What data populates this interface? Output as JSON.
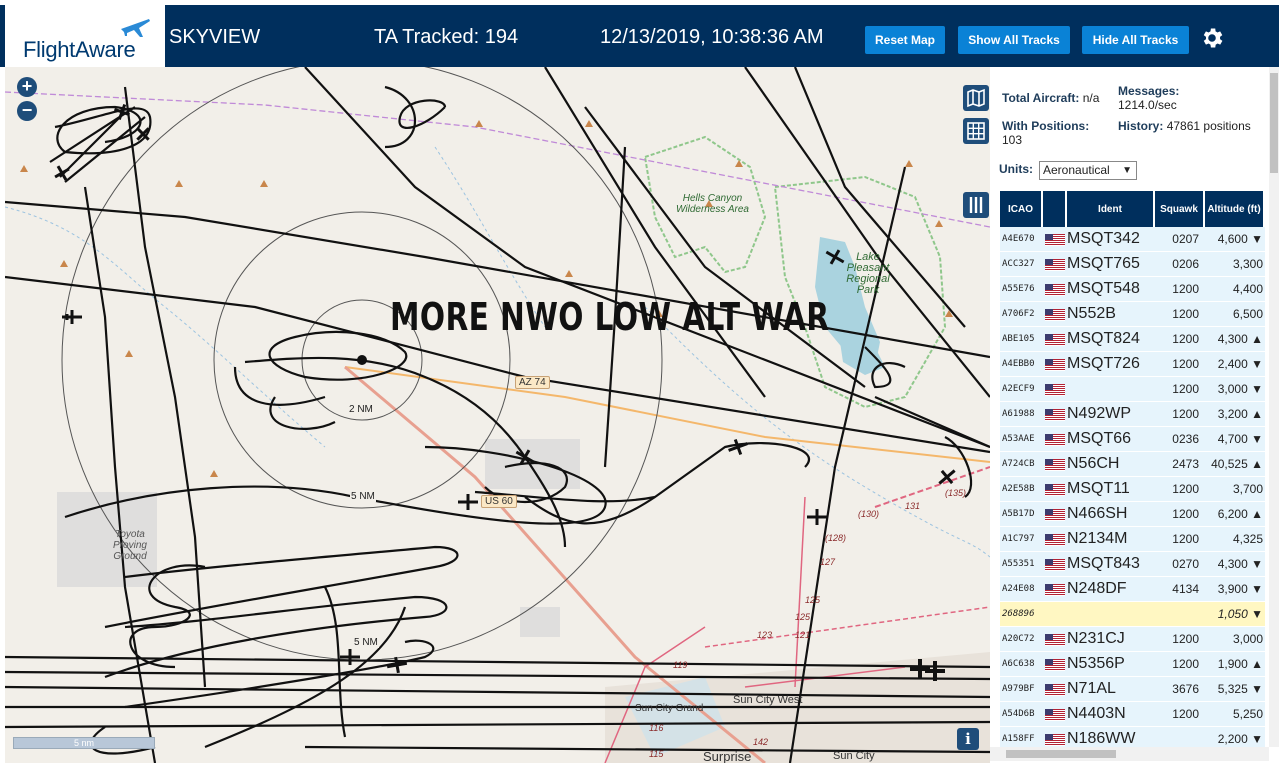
{
  "header": {
    "logo_text": "FlightAware",
    "app_title": "SKYVIEW",
    "tracked": "TA Tracked: 194",
    "datetime": "12/13/2019, 10:38:36 AM",
    "btn_reset": "Reset Map",
    "btn_show": "Show All Tracks",
    "btn_hide": "Hide All Tracks",
    "bar_color": "#002f5d",
    "button_color": "#0a82d6"
  },
  "map": {
    "overlay_title": "MORE NWO LOW ALT WAR",
    "zoom_in": "+",
    "zoom_out": "−",
    "info": "i",
    "scale": "5 nm",
    "range_labels": [
      "2 NM",
      "5 NM",
      "5 NM"
    ],
    "road_az74": "AZ 74",
    "road_us60": "US 60",
    "poi_hells_canyon": "Hells Canyon Wilderness Area",
    "poi_pleasant": "Lake Pleasant Regional Park",
    "poi_toyota": "Toyota Proving Ground",
    "town_sun_city_west": "Sun City West",
    "town_sun_city_grand": "Sun City Grand",
    "town_surprise": "Surprise",
    "town_sun_city": "Sun City",
    "route_numbers": [
      "(130)",
      "(128)",
      "127",
      "125",
      "123",
      "(135)",
      "131",
      "119",
      "116",
      "142",
      "115",
      "125",
      "121"
    ]
  },
  "sidebar": {
    "total_aircraft_label": "Total Aircraft:",
    "total_aircraft_value": "n/a",
    "with_positions_label": "With Positions:",
    "with_positions_value": "103",
    "messages_label": "Messages:",
    "messages_value": "1214.0/sec",
    "history_label": "History:",
    "history_value": "47861 positions",
    "units_label": "Units:",
    "units_value": "Aeronautical",
    "columns": [
      "ICAO",
      "",
      "Ident",
      "Squawk",
      "Altitude (ft)"
    ],
    "rows": [
      {
        "icao": "A4E670",
        "ident": "MSQT342",
        "squawk": "0207",
        "alt": "4,600 ▼",
        "flag": true
      },
      {
        "icao": "ACC327",
        "ident": "MSQT765",
        "squawk": "0206",
        "alt": "3,300",
        "flag": true
      },
      {
        "icao": "A55E76",
        "ident": "MSQT548",
        "squawk": "1200",
        "alt": "4,400",
        "flag": true
      },
      {
        "icao": "A706F2",
        "ident": "N552B",
        "squawk": "1200",
        "alt": "6,500",
        "flag": true
      },
      {
        "icao": "ABE105",
        "ident": "MSQT824",
        "squawk": "1200",
        "alt": "4,300 ▲",
        "flag": true
      },
      {
        "icao": "A4EBB0",
        "ident": "MSQT726",
        "squawk": "1200",
        "alt": "2,400 ▼",
        "flag": true
      },
      {
        "icao": "A2ECF9",
        "ident": "",
        "squawk": "1200",
        "alt": "3,000 ▼",
        "flag": true
      },
      {
        "icao": "A61988",
        "ident": "N492WP",
        "squawk": "1200",
        "alt": "3,200 ▲",
        "flag": true
      },
      {
        "icao": "A53AAE",
        "ident": "MSQT66",
        "squawk": "0236",
        "alt": "4,700 ▼",
        "flag": true
      },
      {
        "icao": "A724CB",
        "ident": "N56CH",
        "squawk": "2473",
        "alt": "40,525 ▲",
        "flag": true
      },
      {
        "icao": "A2E58B",
        "ident": "MSQT11",
        "squawk": "1200",
        "alt": "3,700",
        "flag": true
      },
      {
        "icao": "A5B17D",
        "ident": "N466SH",
        "squawk": "1200",
        "alt": "6,200 ▲",
        "flag": true
      },
      {
        "icao": "A1C797",
        "ident": "N2134M",
        "squawk": "1200",
        "alt": "4,325",
        "flag": true
      },
      {
        "icao": "A55351",
        "ident": "MSQT843",
        "squawk": "0270",
        "alt": "4,300 ▼",
        "flag": true
      },
      {
        "icao": "A24E08",
        "ident": "N248DF",
        "squawk": "4134",
        "alt": "3,900 ▼",
        "flag": true
      },
      {
        "icao": "268896",
        "ident": "",
        "squawk": "",
        "alt": "1,050 ▼",
        "flag": false,
        "highlight": true
      },
      {
        "icao": "A20C72",
        "ident": "N231CJ",
        "squawk": "1200",
        "alt": "3,000",
        "flag": true
      },
      {
        "icao": "A6C638",
        "ident": "N5356P",
        "squawk": "1200",
        "alt": "1,900 ▲",
        "flag": true
      },
      {
        "icao": "A979BF",
        "ident": "N71AL",
        "squawk": "3676",
        "alt": "5,325 ▼",
        "flag": true
      },
      {
        "icao": "A54D6B",
        "ident": "N4403N",
        "squawk": "1200",
        "alt": "5,250",
        "flag": true
      },
      {
        "icao": "A158FF",
        "ident": "N186WW",
        "squawk": "",
        "alt": "2,200 ▼",
        "flag": true
      }
    ]
  }
}
